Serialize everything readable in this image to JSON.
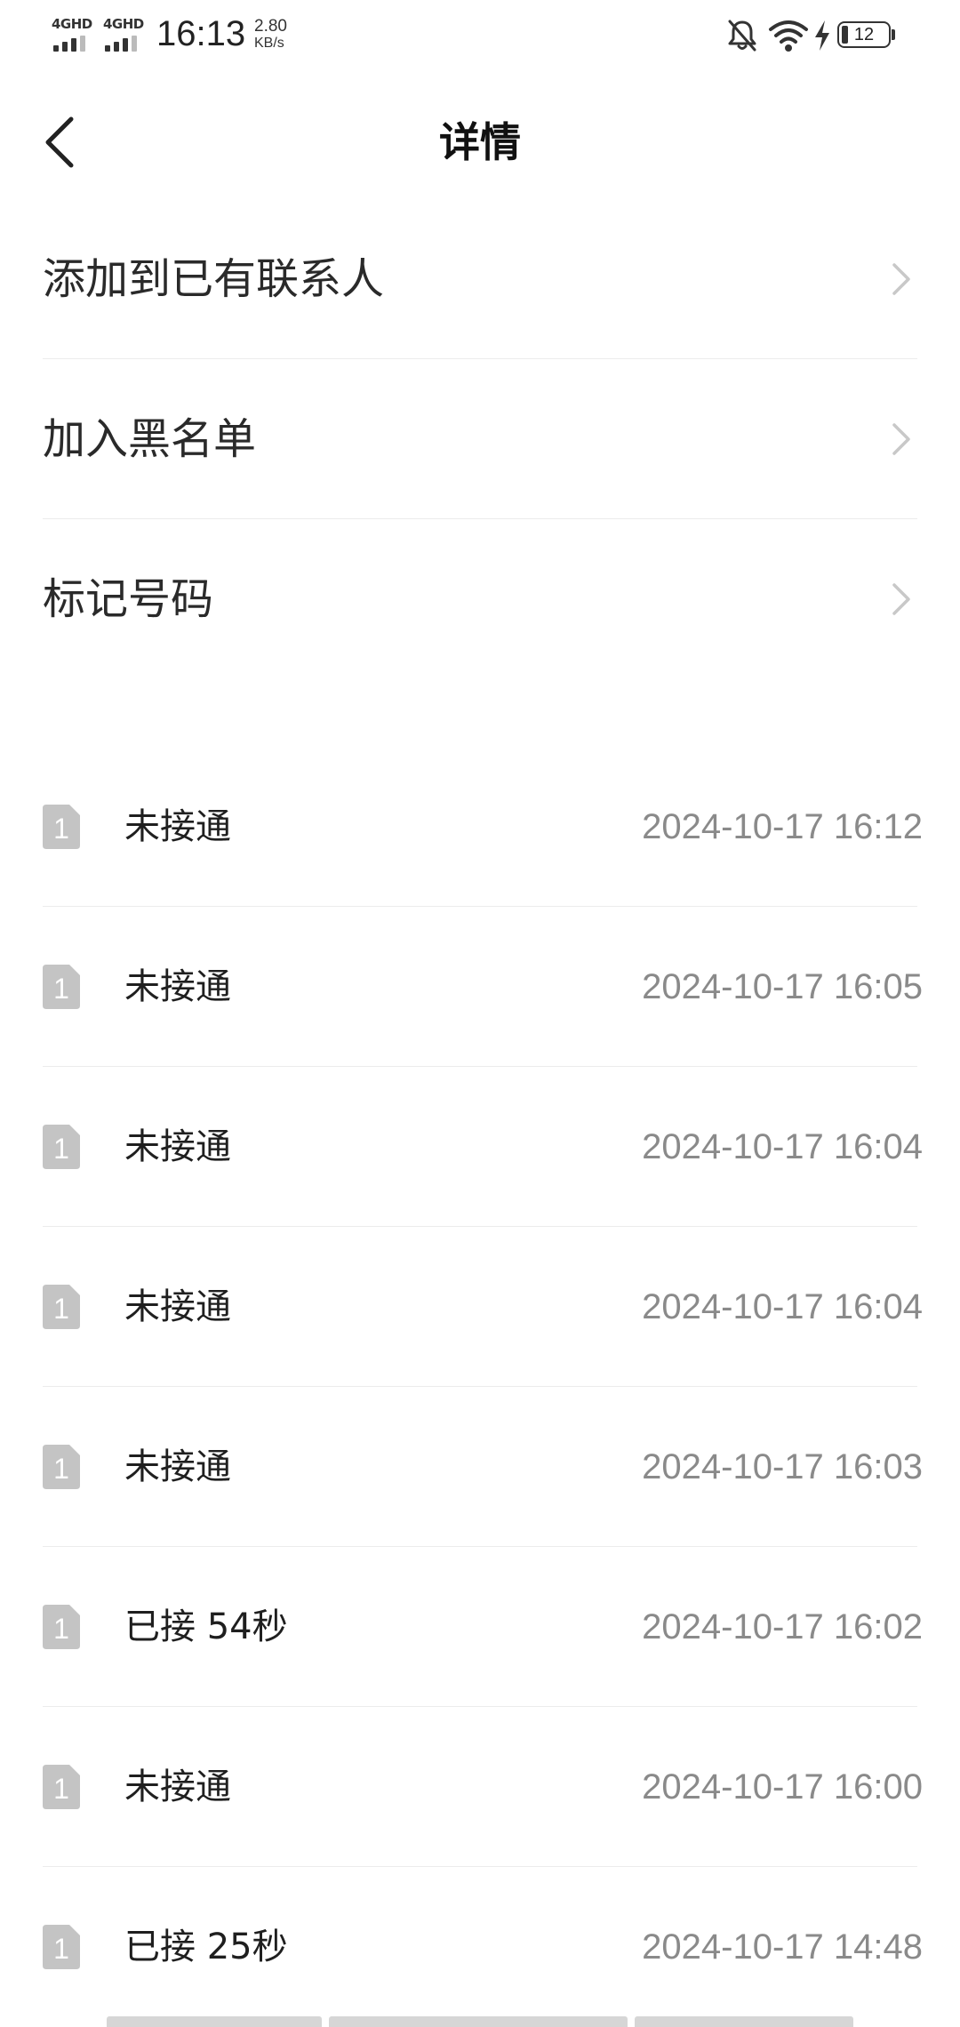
{
  "status_bar": {
    "network_1": "4GHD",
    "network_2": "4GHD",
    "time": "16:13",
    "speed_value": "2.80",
    "speed_unit": "KB/s",
    "icons": [
      "mute-bell-icon",
      "wifi-icon",
      "charging-icon"
    ],
    "battery_level": "12"
  },
  "header": {
    "back_icon": "chevron-left-icon",
    "title": "详情"
  },
  "menu": {
    "items": [
      {
        "label": "添加到已有联系人"
      },
      {
        "label": "加入黑名单"
      },
      {
        "label": "标记号码"
      }
    ]
  },
  "call_log": {
    "sim_label": "1",
    "entries": [
      {
        "status": "未接通",
        "time": "2024-10-17 16:12"
      },
      {
        "status": "未接通",
        "time": "2024-10-17 16:05"
      },
      {
        "status": "未接通",
        "time": "2024-10-17 16:04"
      },
      {
        "status": "未接通",
        "time": "2024-10-17 16:04"
      },
      {
        "status": "未接通",
        "time": "2024-10-17 16:03"
      },
      {
        "status": "已接 54秒",
        "time": "2024-10-17 16:02"
      },
      {
        "status": "未接通",
        "time": "2024-10-17 16:00"
      },
      {
        "status": "已接 25秒",
        "time": "2024-10-17 14:48"
      }
    ]
  },
  "colors": {
    "sim_icon": "#c4c4c4",
    "divider": "#ececec",
    "secondary_text": "#8a8a8a",
    "chevron": "#c8c8c8"
  }
}
